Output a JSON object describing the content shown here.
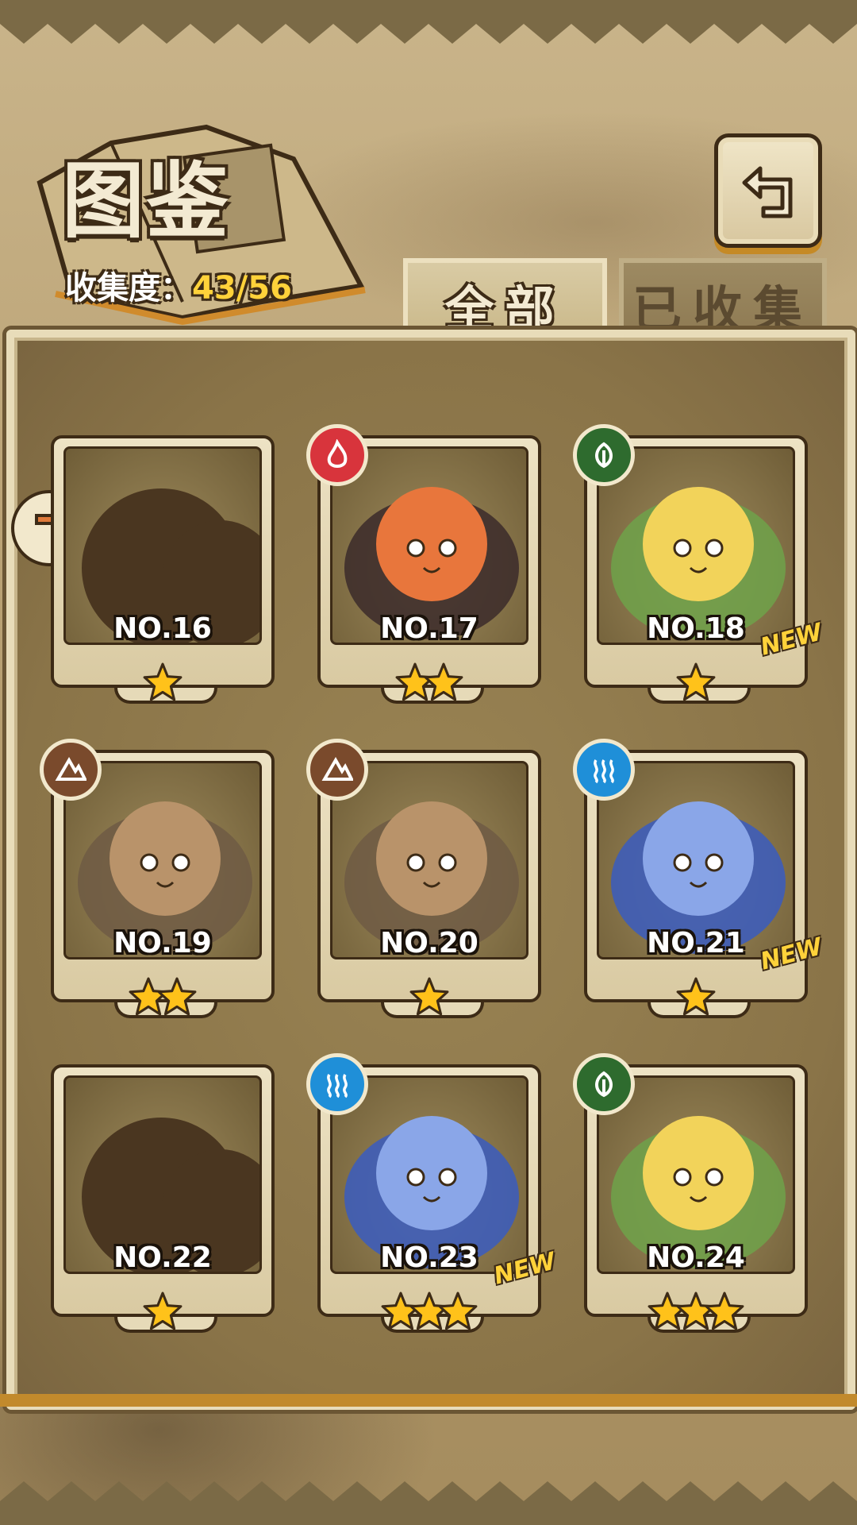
{
  "header": {
    "title": "图鉴",
    "collection_label": "收集度：",
    "collection_value": "43/56"
  },
  "tabs": [
    {
      "label": "全部",
      "selected": true
    },
    {
      "label": "已收集",
      "selected": false
    }
  ],
  "colors": {
    "fire": "#d8343c",
    "grass": "#2e6b2e",
    "earth": "#7a4a2c",
    "water": "#1f8fd8",
    "star": "#ffc21a"
  },
  "cards": [
    {
      "number": "NO.16",
      "stars": 1,
      "element": null,
      "unknown": true,
      "new": false
    },
    {
      "number": "NO.17",
      "stars": 2,
      "element": "fire",
      "unknown": false,
      "new": false
    },
    {
      "number": "NO.18",
      "stars": 1,
      "element": "grass",
      "unknown": false,
      "new": true
    },
    {
      "number": "NO.19",
      "stars": 2,
      "element": "earth",
      "unknown": false,
      "new": false
    },
    {
      "number": "NO.20",
      "stars": 1,
      "element": "earth",
      "unknown": false,
      "new": false
    },
    {
      "number": "NO.21",
      "stars": 1,
      "element": "water",
      "unknown": false,
      "new": true
    },
    {
      "number": "NO.22",
      "stars": 1,
      "element": null,
      "unknown": true,
      "new": false
    },
    {
      "number": "NO.23",
      "stars": 3,
      "element": "water",
      "unknown": false,
      "new": true
    },
    {
      "number": "NO.24",
      "stars": 3,
      "element": "grass",
      "unknown": false,
      "new": false
    }
  ],
  "new_label": "NEW",
  "icons": {
    "back": "return-arrow-icon",
    "side": "chevron-badge-icon"
  }
}
